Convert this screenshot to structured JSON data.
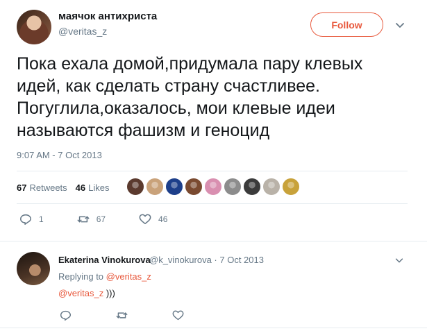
{
  "tweet": {
    "display_name": "маячок антихриста",
    "handle": "@veritas_z",
    "follow_label": "Follow",
    "text": "Пока ехала домой,придумала пару клевых\nидей, как сделать страну счастливее.\nПогуглила,оказалось, мои клевые идеи\nназываются фашизм и геноцид",
    "timestamp": "9:07 AM - 7 Oct 2013",
    "retweets_count": "67",
    "retweets_label": "Retweets",
    "likes_count": "46",
    "likes_label": "Likes",
    "actions": {
      "reply_count": "1",
      "retweet_count": "67",
      "like_count": "46"
    }
  },
  "likers": [
    "#5b3a2e",
    "#c9a27a",
    "#1d3f8a",
    "#7a4a30",
    "#d98fb0",
    "#8c8c8c",
    "#3b3b3b",
    "#b9b2a8",
    "#c8a23a"
  ],
  "reply": {
    "display_name": "Ekaterina Vinokurova",
    "handle": "@k_vinokurova",
    "date": "7 Oct 2013",
    "replying_prefix": "Replying to",
    "replying_to": "@veritas_z",
    "mention": "@veritas_z",
    "text": " )))"
  },
  "colors": {
    "accent": "#e8593d",
    "text": "#14171a",
    "muted": "#657786",
    "divider": "#e6ecf0"
  }
}
